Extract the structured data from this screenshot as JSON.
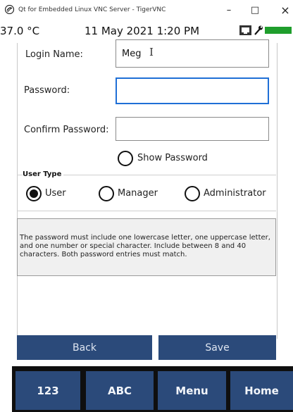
{
  "window": {
    "title": "Qt for Embedded Linux VNC Server - TigerVNC",
    "minimize_glyph": "–",
    "maximize_glyph": "□",
    "close_glyph": "×"
  },
  "status_bar": {
    "temperature": "37.0 °C",
    "datetime": "11 May 2021 1:20 PM",
    "icons": [
      "display-icon",
      "wrench-icon",
      "battery-icon"
    ],
    "battery_color": "#1f9e2c"
  },
  "form": {
    "login_name_label": "Login Name:",
    "login_name_value": "Meg",
    "password_label": "Password:",
    "password_value": "",
    "confirm_password_label": "Confirm Password:",
    "confirm_password_value": "",
    "show_password_label": "Show Password",
    "show_password_checked": false
  },
  "user_type": {
    "title": "User Type",
    "options": [
      {
        "label": "User",
        "selected": true
      },
      {
        "label": "Manager",
        "selected": false
      },
      {
        "label": "Administrator",
        "selected": false
      }
    ]
  },
  "info": {
    "text": "The password must include one lowercase letter, one uppercase letter, and one number or special character. Include between 8 and 40 characters. Both password entries must match."
  },
  "actions": {
    "back_label": "Back",
    "save_label": "Save"
  },
  "keyboard_bar": {
    "buttons": [
      "123",
      "ABC",
      "Menu",
      "Home"
    ]
  },
  "colors": {
    "button_blue": "#2b4a7a",
    "focus_blue": "#1f6fd6",
    "keyboard_bg": "#0f0f0f"
  }
}
